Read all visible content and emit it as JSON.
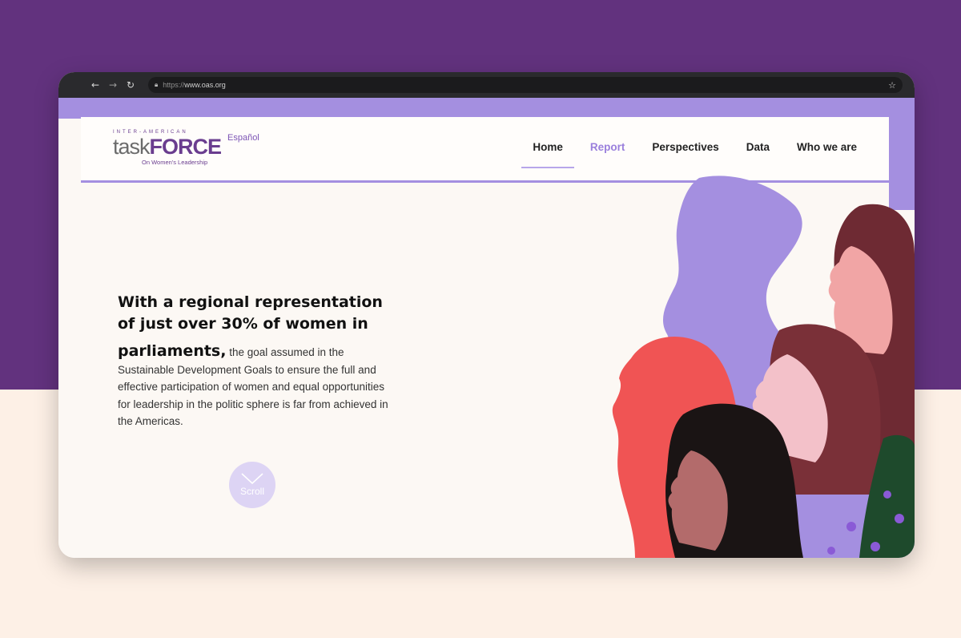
{
  "browser": {
    "url_scheme": "https://",
    "url_host": "www.oas.org",
    "icons": {
      "back": "arrow-left-icon",
      "forward": "arrow-right-icon",
      "reload": "reload-icon",
      "lock": "lock-icon",
      "bookmark": "star-icon"
    }
  },
  "header": {
    "logo": {
      "top_line": "INTER-AMERICAN",
      "task": "task",
      "force": "FORCE",
      "subtitle": "On Women's Leadership"
    },
    "language_link": "Español",
    "nav": [
      "Home",
      "Report",
      "Perspectives",
      "Data",
      "Who we are"
    ],
    "active_nav": "Home"
  },
  "hero": {
    "headline_part1": "With a regional representation of just over 30% of women in",
    "headline_part2": "parliaments,",
    "body": " the goal assumed in the Sustainable Development Goals to ensure the full and effective participation of women and equal opportunities for leadership in the politic sphere is far from achieved in the Americas.",
    "scroll_label": "Scroll"
  },
  "colors": {
    "background_purple": "#62327e",
    "background_cream": "#fdf0e6",
    "accent_lavender": "#a48fe0",
    "report_link": "#9a7fdc",
    "brand_purple": "#6a3d8f"
  }
}
